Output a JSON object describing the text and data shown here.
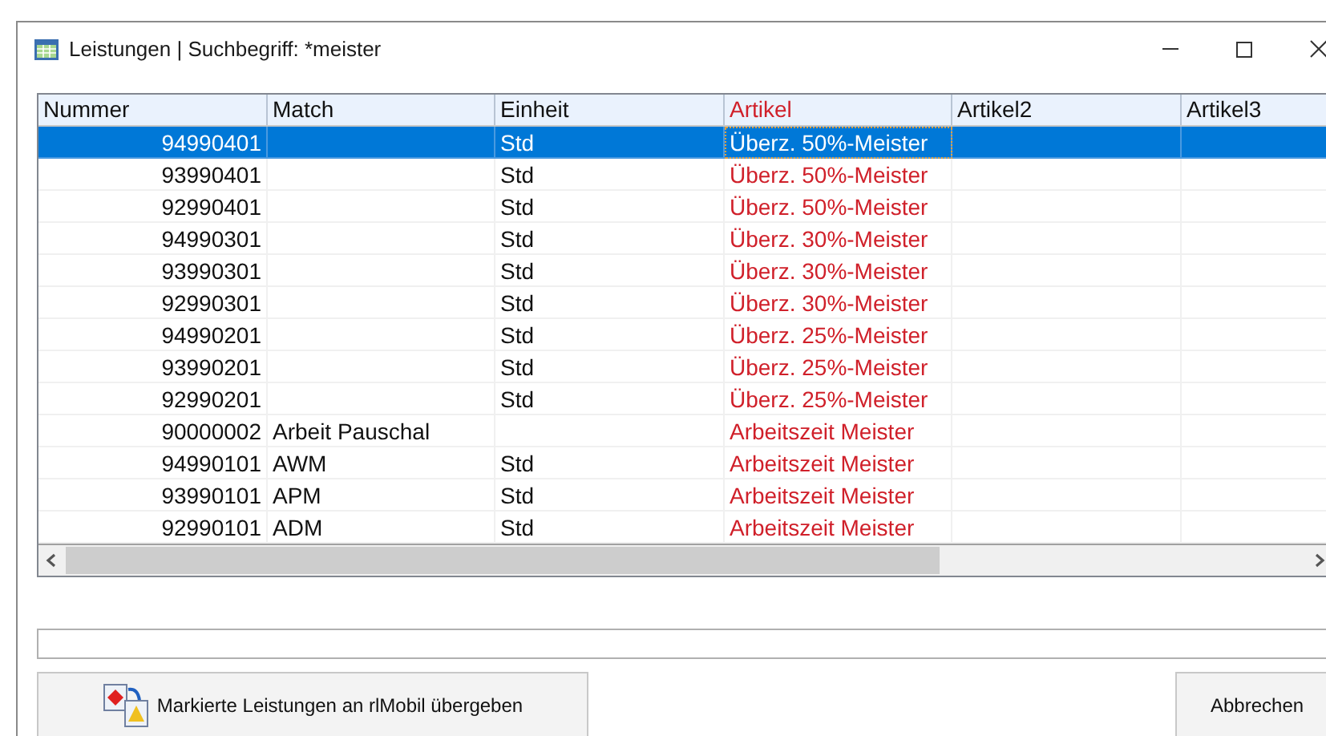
{
  "window": {
    "title": "Leistungen | Suchbegriff: *meister"
  },
  "table": {
    "columns": [
      {
        "label": "Nummer"
      },
      {
        "label": "Match"
      },
      {
        "label": "Einheit"
      },
      {
        "label": "Artikel",
        "color": "#d0202a"
      },
      {
        "label": "Artikel2"
      },
      {
        "label": "Artikel3"
      }
    ],
    "rows": [
      {
        "nummer": "94990401",
        "einheit": "Std",
        "artikel": "Überz. 50%-Meister",
        "selected": true
      },
      {
        "nummer": "93990401",
        "einheit": "Std",
        "artikel": "Überz. 50%-Meister",
        "selected": false
      },
      {
        "nummer": "92990401",
        "einheit": "Std",
        "artikel": "Überz. 50%-Meister",
        "selected": false
      },
      {
        "nummer": "94990301",
        "einheit": "Std",
        "artikel": "Überz. 30%-Meister",
        "selected": false
      },
      {
        "nummer": "93990301",
        "einheit": "Std",
        "artikel": "Überz. 30%-Meister",
        "selected": false
      },
      {
        "nummer": "92990301",
        "einheit": "Std",
        "artikel": "Überz. 30%-Meister",
        "selected": false
      },
      {
        "nummer": "94990201",
        "einheit": "Std",
        "artikel": "Überz. 25%-Meister",
        "selected": false
      },
      {
        "nummer": "93990201",
        "einheit": "Std",
        "artikel": "Überz. 25%-Meister",
        "selected": false
      },
      {
        "nummer": "92990201",
        "einheit": "Std",
        "artikel": "Überz. 25%-Meister",
        "selected": false
      },
      {
        "nummer": "90000002",
        "match": "Arbeit Pauschal",
        "artikel": "Arbeitszeit Meister",
        "selected": false
      },
      {
        "nummer": "94990101",
        "match": "AWM",
        "einheit": "Std",
        "artikel": "Arbeitszeit Meister",
        "selected": false
      },
      {
        "nummer": "93990101",
        "match": "APM",
        "einheit": "Std",
        "artikel": "Arbeitszeit Meister",
        "selected": false
      },
      {
        "nummer": "92990101",
        "match": "ADM",
        "einheit": "Std",
        "artikel": "Arbeitszeit Meister",
        "selected": false
      }
    ]
  },
  "buttons": [
    {
      "label": "Markierte Leistungen an rlMobil übergeben",
      "kind": "transfer"
    },
    {
      "label": "Abbrechen",
      "kind": "cancel"
    }
  ]
}
